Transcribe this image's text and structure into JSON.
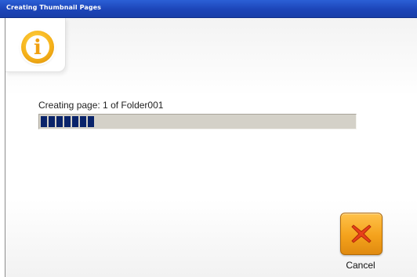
{
  "window": {
    "title": "Creating Thumbnail Pages"
  },
  "dialog": {
    "icon": "info-icon",
    "status_text": "Creating page: 1 of Folder001",
    "progress": {
      "fraction": 0.17,
      "color": "#0a246a",
      "track_color": "#d4d1c8"
    }
  },
  "buttons": {
    "cancel": {
      "label": "Cancel",
      "icon": "close-x-icon",
      "color": "#f4a21c"
    }
  },
  "colors": {
    "titlebar": "#1c45b8",
    "info_icon": "#f6b21a"
  }
}
